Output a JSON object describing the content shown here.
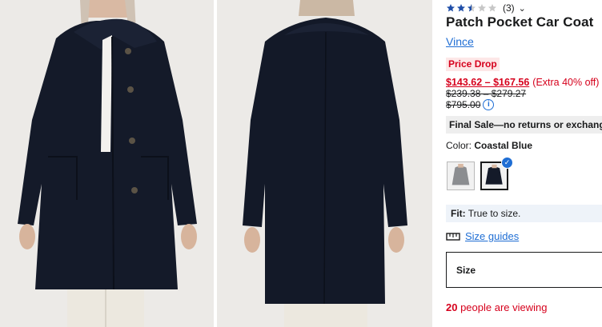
{
  "product": {
    "rating": {
      "value": 2.5,
      "max": 5,
      "count_text": "(3)",
      "chevron_icon": "chevron-down-icon"
    },
    "title": "Patch Pocket Car Coat",
    "brand": "Vince",
    "badge": "Price Drop",
    "price": {
      "sale_range": "$143.62 – $167.56",
      "extra": "(Extra 40% off)",
      "was_range": "$239.38 – $279.27",
      "original": "$795.00",
      "info_icon": "info-icon"
    },
    "final_sale": "Final Sale—no returns or exchanges",
    "color": {
      "label": "Color: ",
      "value": "Coastal Blue",
      "swatches": [
        {
          "name": "gray",
          "selected": false
        },
        {
          "name": "coastal-blue",
          "selected": true
        }
      ]
    },
    "fit": {
      "label": "Fit:",
      "value": " True to size."
    },
    "size_guides": "Size guides",
    "size_label": "Size",
    "viewing": {
      "count": "20",
      "text": " people are viewing"
    }
  },
  "colors": {
    "accent_blue": "#1f6ed4",
    "sale_red": "#d6001c",
    "badge_bg": "#fde7e7",
    "star_blue": "#1f4ea8",
    "coat_navy": "#141a29",
    "photo_bg": "#ecebe9"
  }
}
